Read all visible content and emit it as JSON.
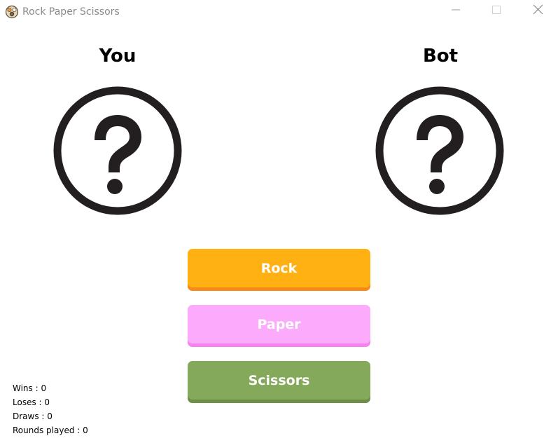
{
  "window": {
    "title": "Rock Paper Scissors",
    "controls": [
      "minimize-icon",
      "maximize-icon",
      "close-icon"
    ]
  },
  "players": {
    "you": {
      "label": "You",
      "choice_icon": "question-mark-icon"
    },
    "bot": {
      "label": "Bot",
      "choice_icon": "question-mark-icon"
    }
  },
  "actions": {
    "rock": {
      "label": "Rock",
      "color": "#ffb013"
    },
    "paper": {
      "label": "Paper",
      "color": "#fcabfc"
    },
    "scissors": {
      "label": "Scissors",
      "color": "#84a95b"
    }
  },
  "stats": {
    "wins": "Wins : 0",
    "loses": "Loses : 0",
    "draws": "Draws : 0",
    "rounds": "Rounds played : 0"
  }
}
